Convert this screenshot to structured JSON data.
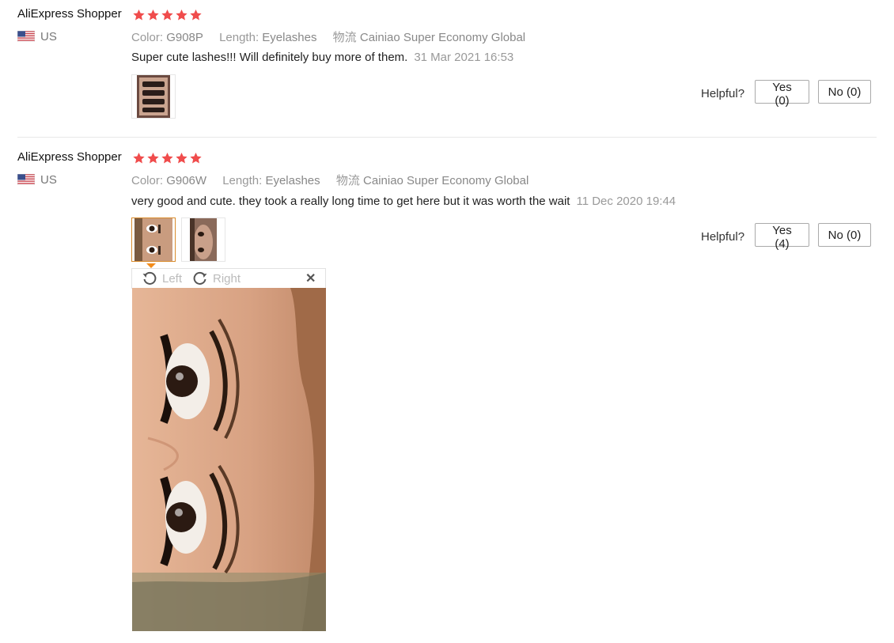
{
  "reviews": [
    {
      "user": "AliExpress Shopper",
      "country": "US",
      "color_label": "Color:",
      "color_value": "G908P",
      "length_label": "Length:",
      "length_value": "Eyelashes",
      "shipping_label": "物流",
      "shipping_value": "Cainiao Super Economy Global",
      "text": "Super cute lashes!!! Will definitely buy more of them.",
      "date": "31 Mar 2021 16:53",
      "helpful_label": "Helpful?",
      "yes_label": "Yes (0)",
      "no_label": "No (0)"
    },
    {
      "user": "AliExpress Shopper",
      "country": "US",
      "color_label": "Color:",
      "color_value": "G906W",
      "length_label": "Length:",
      "length_value": "Eyelashes",
      "shipping_label": "物流",
      "shipping_value": "Cainiao Super Economy Global",
      "text": "very good and cute. they took a really long time to get here but it was worth the wait",
      "date": "11 Dec 2020 19:44",
      "helpful_label": "Helpful?",
      "yes_label": "Yes (4)",
      "no_label": "No (0)"
    }
  ],
  "viewer": {
    "rotate_left_label": "Left",
    "rotate_right_label": "Right",
    "close_icon": "close-icon"
  },
  "colors": {
    "star": "#f04c4c",
    "selected_border": "#d98b2b",
    "caret": "#f28c1c"
  }
}
